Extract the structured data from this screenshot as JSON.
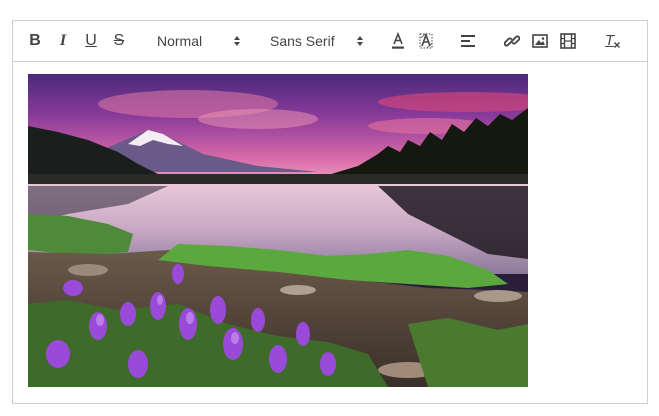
{
  "toolbar": {
    "bold_label": "B",
    "italic_label": "I",
    "underline_label": "U",
    "strike_label": "S",
    "size_select": {
      "value": "Normal"
    },
    "font_select": {
      "value": "Sans Serif"
    },
    "clean_label": "T"
  },
  "icons": {
    "bold": "bold-icon",
    "italic": "italic-icon",
    "underline": "underline-icon",
    "strike": "strikethrough-icon",
    "color": "text-color-icon",
    "background": "background-color-icon",
    "align": "align-left-icon",
    "link": "link-icon",
    "image": "image-icon",
    "video": "video-icon",
    "clean": "clear-format-icon"
  },
  "colors": {
    "toolbar_icon": "#444444",
    "border": "#cfcfcf"
  },
  "content": {
    "image_subject": "mountain-lake-sunset-photo"
  }
}
